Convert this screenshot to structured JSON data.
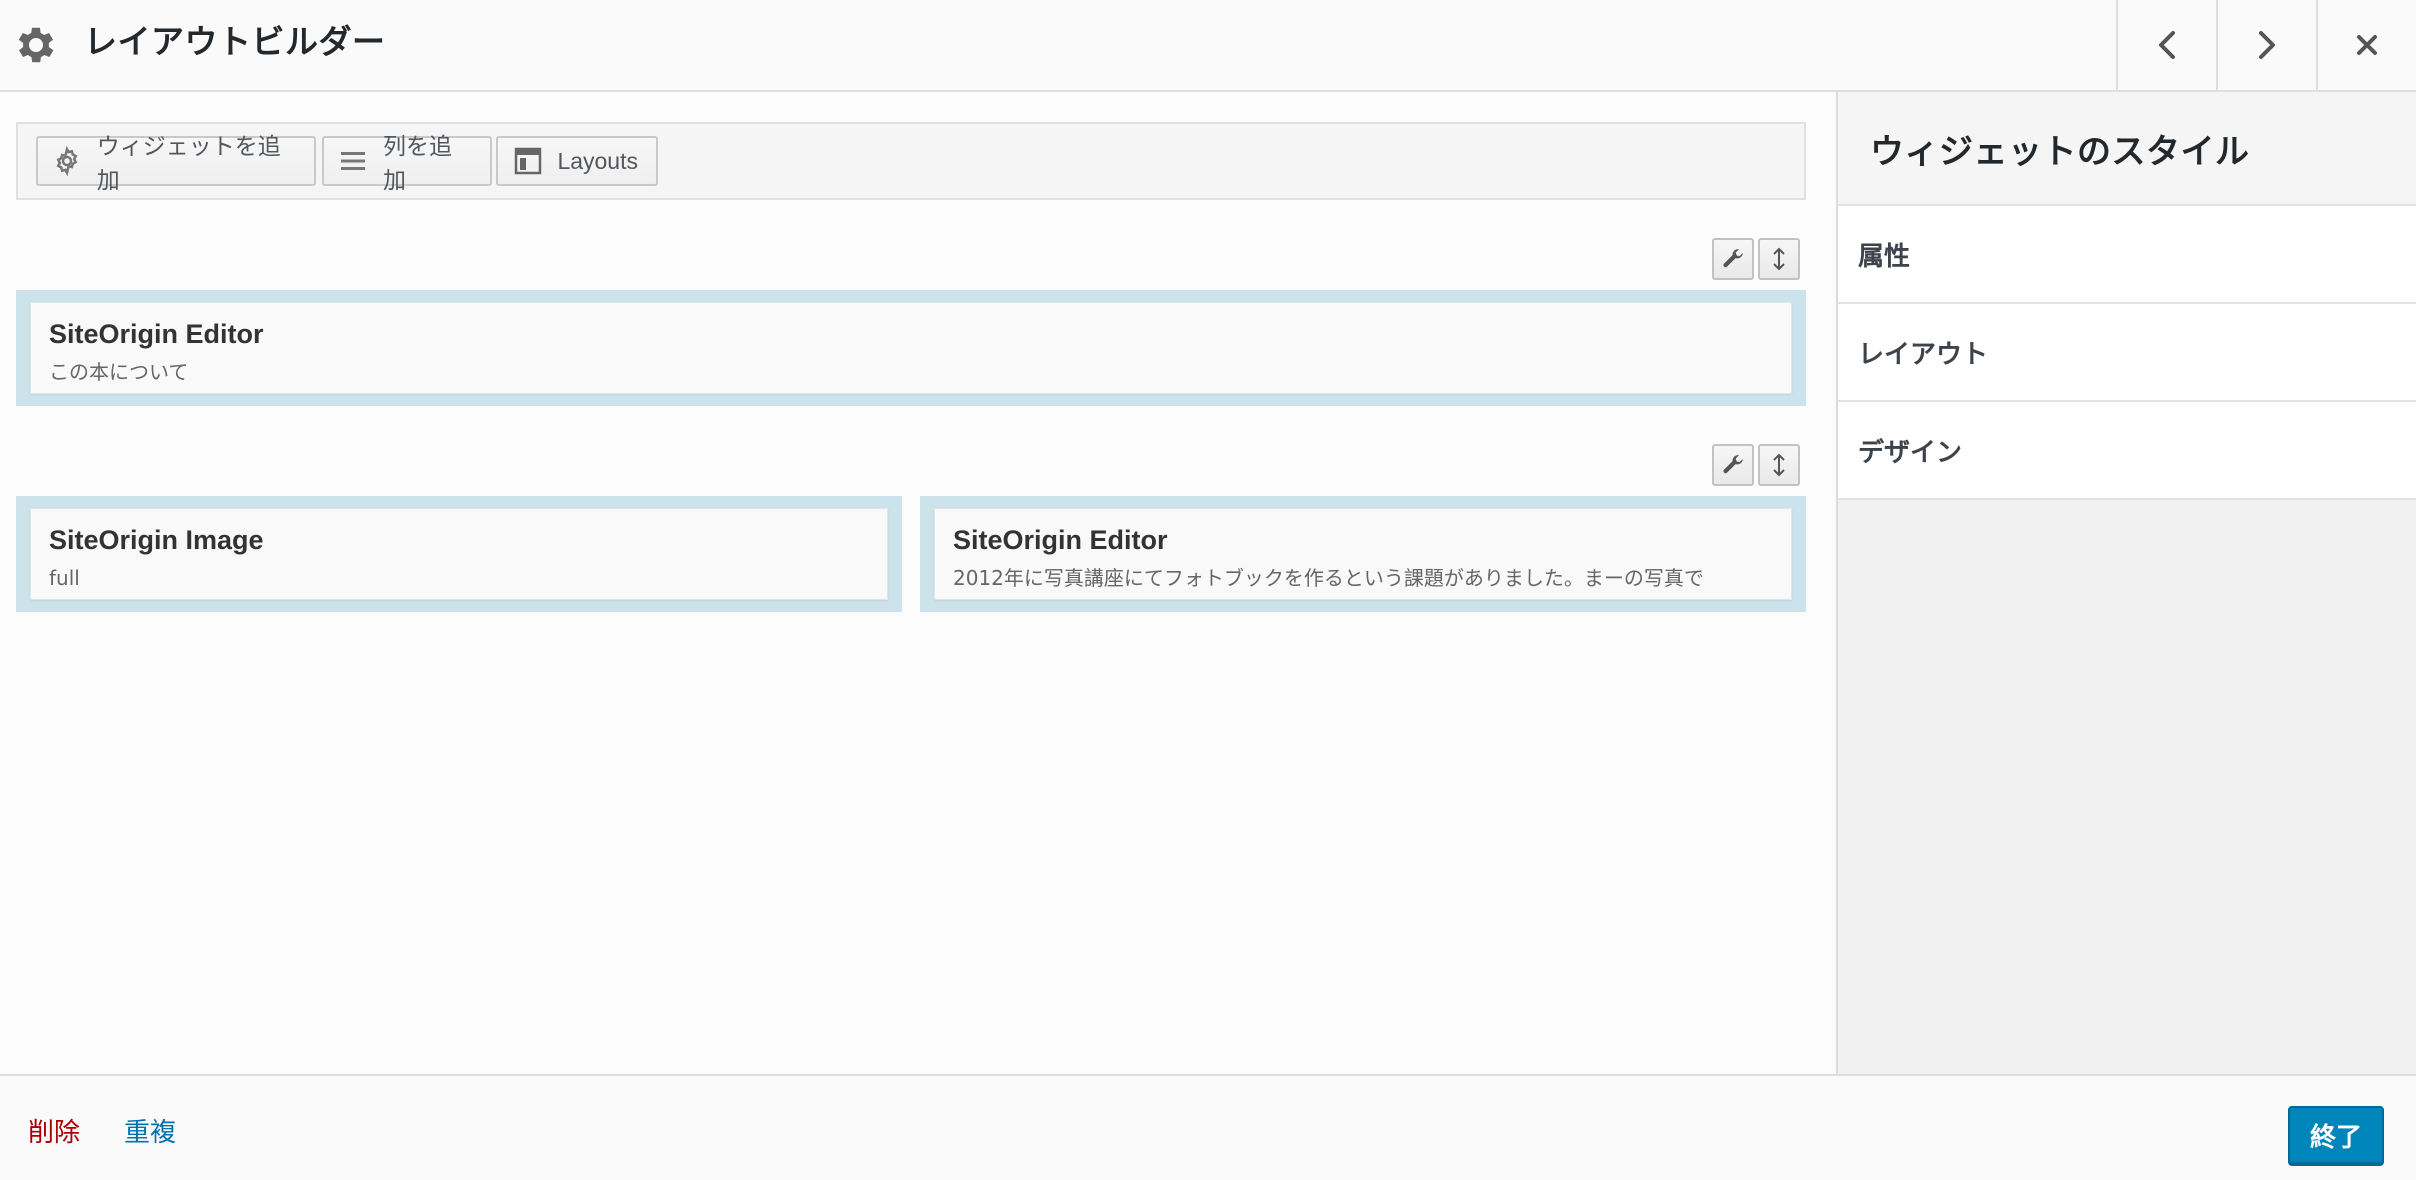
{
  "header": {
    "title": "レイアウトビルダー",
    "icons": {
      "settings": "gear-icon",
      "prev": "chevron-left-icon",
      "next": "chevron-right-icon",
      "close": "close-icon"
    }
  },
  "toolbar": {
    "add_widget_label": "ウィジェットを追加",
    "add_row_label": "列を追加",
    "layouts_label": "Layouts"
  },
  "rows": [
    {
      "cells": [
        {
          "widget_title": "SiteOrigin Editor",
          "widget_desc": "この本について"
        }
      ]
    },
    {
      "cells": [
        {
          "widget_title": "SiteOrigin Image",
          "widget_desc": "full"
        },
        {
          "widget_title": "SiteOrigin Editor",
          "widget_desc": "2012年に写真講座にてフォトブックを作るという課題がありました。まーの写真で"
        }
      ]
    }
  ],
  "sidebar": {
    "title": "ウィジェットのスタイル",
    "sections": [
      "属性",
      "レイアウト",
      "デザイン"
    ]
  },
  "footer": {
    "delete_label": "削除",
    "duplicate_label": "重複",
    "done_label": "終了"
  },
  "colors": {
    "accent": "#0085ba",
    "cell_bg": "#cde3ec",
    "delete": "#aa0000",
    "link": "#0073aa"
  }
}
